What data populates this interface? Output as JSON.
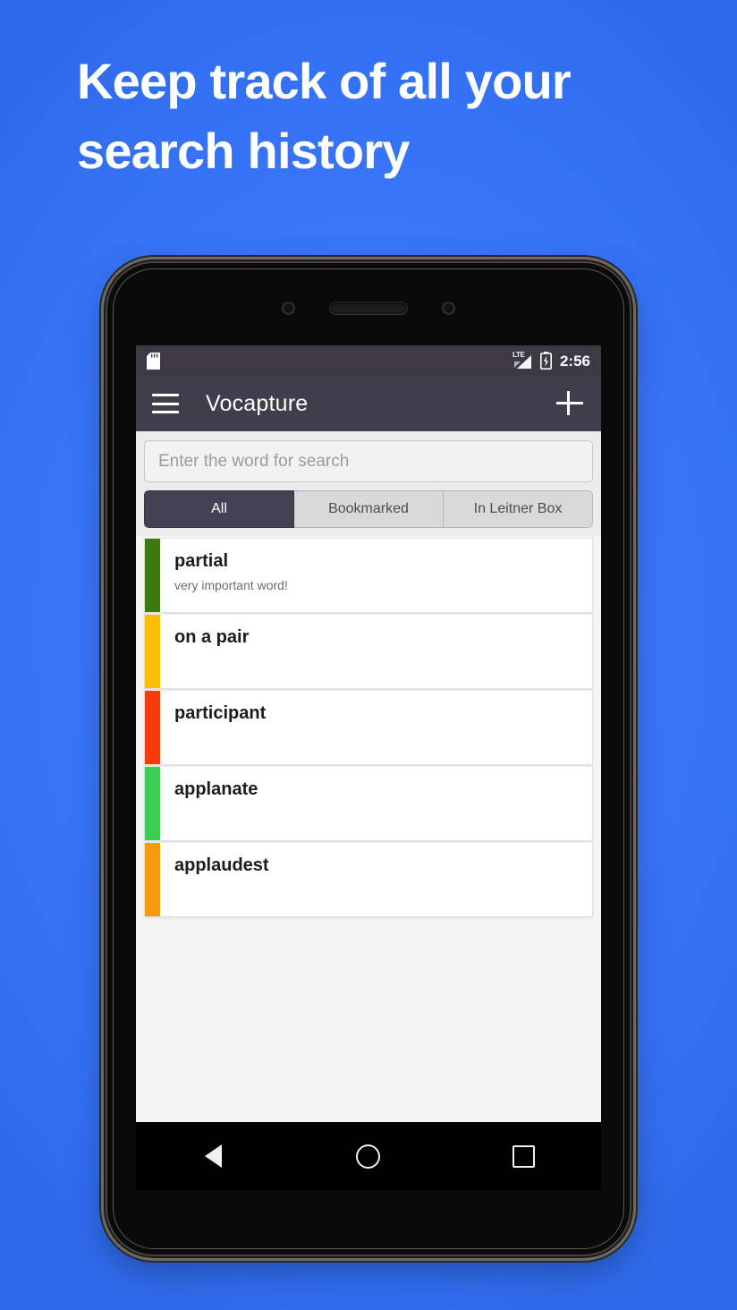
{
  "promo": {
    "headline": "Keep track of all your\nsearch history",
    "background_color": "#3b77fb"
  },
  "status_bar": {
    "sd_card_icon": "sd-card-icon",
    "network_label": "LTE",
    "signal_icon": "signal-bars-icon",
    "battery_icon": "battery-charging-icon",
    "time": "2:56",
    "background_color": "#3d3a46"
  },
  "app_bar": {
    "menu_icon": "hamburger-menu-icon",
    "title": "Vocapture",
    "add_icon": "plus-icon",
    "background_color": "#413e4b"
  },
  "search": {
    "placeholder": "Enter the word for search",
    "value": ""
  },
  "filter_tabs": {
    "active_index": 0,
    "items": [
      {
        "label": "All",
        "active": true
      },
      {
        "label": "Bookmarked",
        "active": false
      },
      {
        "label": "In Leitner Box",
        "active": false
      }
    ],
    "active_color": "#454154",
    "inactive_color": "#d9d9d9"
  },
  "word_list": {
    "items": [
      {
        "word": "partial",
        "note": "very important word!",
        "accent": "#3a7a0e"
      },
      {
        "word": "on a pair",
        "note": "",
        "accent": "#fcc000"
      },
      {
        "word": "participant",
        "note": "",
        "accent": "#f93a0a"
      },
      {
        "word": "applanate",
        "note": "",
        "accent": "#3ccd54"
      },
      {
        "word": "applaudest",
        "note": "",
        "accent": "#f79a0d"
      }
    ]
  },
  "nav_bar": {
    "back_icon": "back-triangle-icon",
    "home_icon": "home-circle-icon",
    "recents_icon": "recents-square-icon"
  }
}
